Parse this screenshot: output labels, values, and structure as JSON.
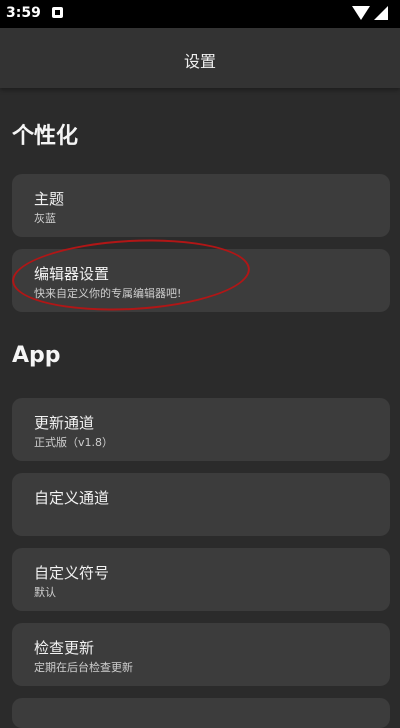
{
  "status_bar": {
    "time": "3:59"
  },
  "app_bar": {
    "title": "设置"
  },
  "sections": {
    "personalization": "个性化",
    "app": "App"
  },
  "items": {
    "theme": {
      "title": "主题",
      "subtitle": "灰蓝"
    },
    "editor": {
      "title": "编辑器设置",
      "subtitle": "快来自定义你的专属编辑器吧!"
    },
    "update_channel": {
      "title": "更新通道",
      "subtitle": "正式版（v1.8）"
    },
    "custom_channel": {
      "title": "自定义通道"
    },
    "custom_symbol": {
      "title": "自定义符号",
      "subtitle": "默认"
    },
    "check_update": {
      "title": "检查更新",
      "subtitle": "定期在后台检查更新"
    }
  },
  "colors": {
    "background": "#2b2b2b",
    "card": "#3c3c3c",
    "app_bar": "#333333",
    "annotation": "#b11616"
  }
}
